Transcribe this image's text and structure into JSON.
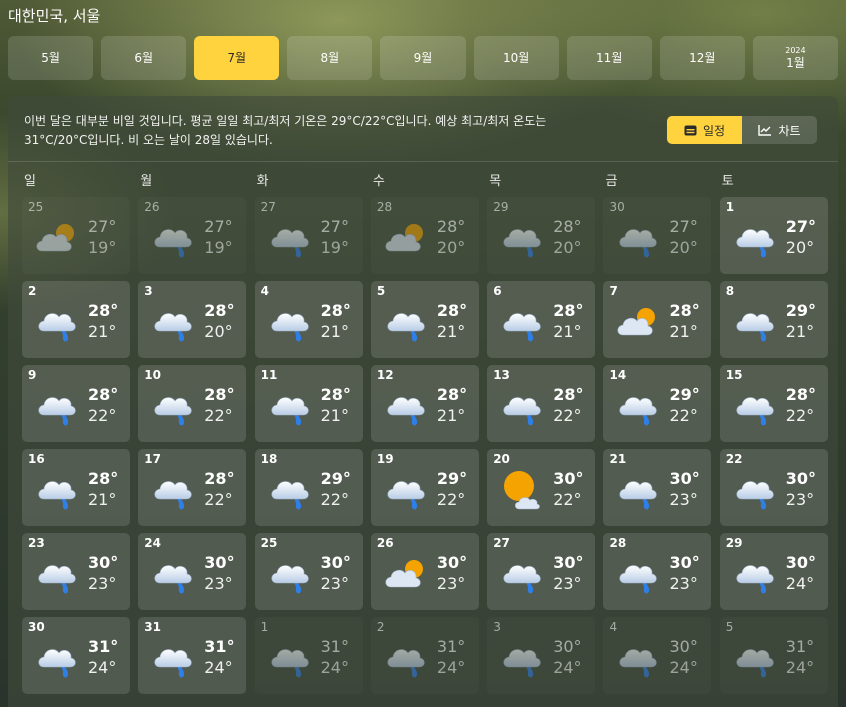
{
  "location": "대한민국, 서울",
  "months": [
    {
      "label": "5월",
      "year": "",
      "active": false
    },
    {
      "label": "6월",
      "year": "",
      "active": false
    },
    {
      "label": "7월",
      "year": "",
      "active": true
    },
    {
      "label": "8월",
      "year": "",
      "active": false
    },
    {
      "label": "9월",
      "year": "",
      "active": false
    },
    {
      "label": "10월",
      "year": "",
      "active": false
    },
    {
      "label": "11월",
      "year": "",
      "active": false
    },
    {
      "label": "12월",
      "year": "",
      "active": false
    },
    {
      "label": "1월",
      "year": "2024",
      "active": false
    }
  ],
  "summary": "이번 달은 대부분 비일 것입니다. 평균 일일 최고/최저 기온은 29°C/22°C입니다. 예상 최고/최저 온도는 31°C/20°C입니다. 비 오는 날이 28일 있습니다.",
  "view_toggle": {
    "calendar_label": "일정",
    "chart_label": "차트",
    "selected": "calendar"
  },
  "weekdays": [
    "일",
    "월",
    "화",
    "수",
    "목",
    "금",
    "토"
  ],
  "days": [
    {
      "date": "25",
      "high": "27°",
      "low": "19°",
      "icon": "partly-cloudy-icon",
      "other_month": true
    },
    {
      "date": "26",
      "high": "27°",
      "low": "19°",
      "icon": "rain-icon",
      "other_month": true
    },
    {
      "date": "27",
      "high": "27°",
      "low": "19°",
      "icon": "rain-icon",
      "other_month": true
    },
    {
      "date": "28",
      "high": "28°",
      "low": "20°",
      "icon": "partly-cloudy-icon",
      "other_month": true
    },
    {
      "date": "29",
      "high": "28°",
      "low": "20°",
      "icon": "rain-icon",
      "other_month": true
    },
    {
      "date": "30",
      "high": "27°",
      "low": "20°",
      "icon": "rain-icon",
      "other_month": true
    },
    {
      "date": "1",
      "high": "27°",
      "low": "20°",
      "icon": "rain-icon",
      "other_month": false
    },
    {
      "date": "2",
      "high": "28°",
      "low": "21°",
      "icon": "rain-icon",
      "other_month": false
    },
    {
      "date": "3",
      "high": "28°",
      "low": "20°",
      "icon": "rain-icon",
      "other_month": false
    },
    {
      "date": "4",
      "high": "28°",
      "low": "21°",
      "icon": "rain-icon",
      "other_month": false
    },
    {
      "date": "5",
      "high": "28°",
      "low": "21°",
      "icon": "rain-icon",
      "other_month": false
    },
    {
      "date": "6",
      "high": "28°",
      "low": "21°",
      "icon": "rain-icon",
      "other_month": false
    },
    {
      "date": "7",
      "high": "28°",
      "low": "21°",
      "icon": "partly-cloudy-icon",
      "other_month": false
    },
    {
      "date": "8",
      "high": "29°",
      "low": "21°",
      "icon": "rain-icon",
      "other_month": false
    },
    {
      "date": "9",
      "high": "28°",
      "low": "22°",
      "icon": "rain-icon",
      "other_month": false
    },
    {
      "date": "10",
      "high": "28°",
      "low": "22°",
      "icon": "rain-icon",
      "other_month": false
    },
    {
      "date": "11",
      "high": "28°",
      "low": "21°",
      "icon": "rain-icon",
      "other_month": false
    },
    {
      "date": "12",
      "high": "28°",
      "low": "21°",
      "icon": "rain-icon",
      "other_month": false
    },
    {
      "date": "13",
      "high": "28°",
      "low": "22°",
      "icon": "rain-icon",
      "other_month": false
    },
    {
      "date": "14",
      "high": "29°",
      "low": "22°",
      "icon": "rain-icon",
      "other_month": false
    },
    {
      "date": "15",
      "high": "28°",
      "low": "22°",
      "icon": "rain-icon",
      "other_month": false
    },
    {
      "date": "16",
      "high": "28°",
      "low": "21°",
      "icon": "rain-icon",
      "other_month": false
    },
    {
      "date": "17",
      "high": "28°",
      "low": "22°",
      "icon": "rain-icon",
      "other_month": false
    },
    {
      "date": "18",
      "high": "29°",
      "low": "22°",
      "icon": "rain-icon",
      "other_month": false
    },
    {
      "date": "19",
      "high": "29°",
      "low": "22°",
      "icon": "rain-icon",
      "other_month": false
    },
    {
      "date": "20",
      "high": "30°",
      "low": "22°",
      "icon": "mostly-sunny-icon",
      "other_month": false
    },
    {
      "date": "21",
      "high": "30°",
      "low": "23°",
      "icon": "rain-icon",
      "other_month": false
    },
    {
      "date": "22",
      "high": "30°",
      "low": "23°",
      "icon": "rain-icon",
      "other_month": false
    },
    {
      "date": "23",
      "high": "30°",
      "low": "23°",
      "icon": "rain-icon",
      "other_month": false
    },
    {
      "date": "24",
      "high": "30°",
      "low": "23°",
      "icon": "rain-icon",
      "other_month": false
    },
    {
      "date": "25",
      "high": "30°",
      "low": "23°",
      "icon": "rain-icon",
      "other_month": false
    },
    {
      "date": "26",
      "high": "30°",
      "low": "23°",
      "icon": "partly-cloudy-icon",
      "other_month": false
    },
    {
      "date": "27",
      "high": "30°",
      "low": "23°",
      "icon": "rain-icon",
      "other_month": false
    },
    {
      "date": "28",
      "high": "30°",
      "low": "23°",
      "icon": "rain-icon",
      "other_month": false
    },
    {
      "date": "29",
      "high": "30°",
      "low": "24°",
      "icon": "rain-icon",
      "other_month": false
    },
    {
      "date": "30",
      "high": "31°",
      "low": "24°",
      "icon": "rain-icon",
      "other_month": false
    },
    {
      "date": "31",
      "high": "31°",
      "low": "24°",
      "icon": "rain-icon",
      "other_month": false
    },
    {
      "date": "1",
      "high": "31°",
      "low": "24°",
      "icon": "rain-icon",
      "other_month": true
    },
    {
      "date": "2",
      "high": "31°",
      "low": "24°",
      "icon": "rain-icon",
      "other_month": true
    },
    {
      "date": "3",
      "high": "30°",
      "low": "24°",
      "icon": "rain-icon",
      "other_month": true
    },
    {
      "date": "4",
      "high": "30°",
      "low": "24°",
      "icon": "rain-icon",
      "other_month": true
    },
    {
      "date": "5",
      "high": "31°",
      "low": "24°",
      "icon": "rain-icon",
      "other_month": true
    }
  ]
}
